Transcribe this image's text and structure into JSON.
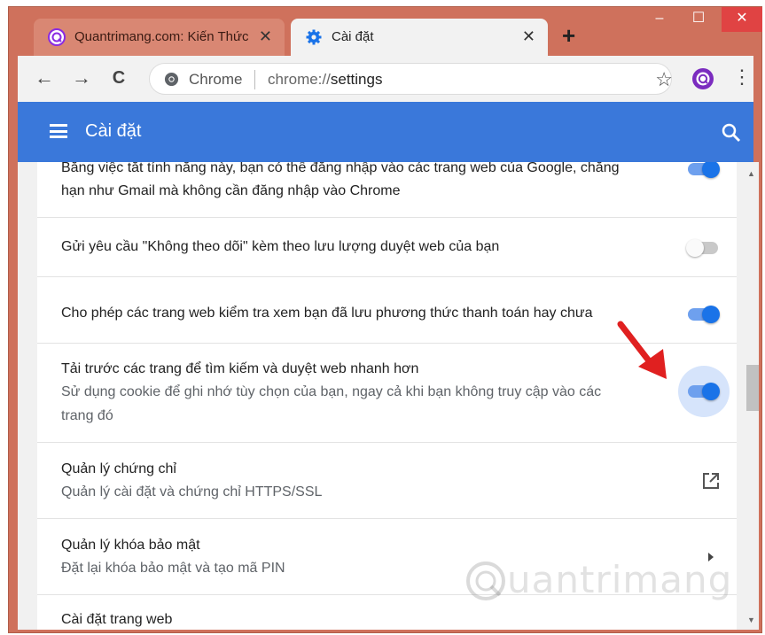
{
  "window": {
    "minimize": "–",
    "maximize": "☐",
    "close": "✕"
  },
  "tabs": [
    {
      "title": "Quantrimang.com: Kiến Thức",
      "close": "✕"
    },
    {
      "title": "Cài đặt",
      "close": "✕"
    }
  ],
  "new_tab": "+",
  "toolbar": {
    "back": "←",
    "forward": "→",
    "reload": "C",
    "chip": "Chrome",
    "url_scheme": "chrome://",
    "url_path": "settings",
    "star": "☆",
    "menu": "⋮"
  },
  "header": {
    "title": "Cài đặt"
  },
  "settings": [
    {
      "primary": "Bằng việc tắt tính năng này, bạn có thể đăng nhập vào các trang web của Google, chẳng",
      "secondary": "hạn như Gmail mà không cần đăng nhập vào Chrome",
      "toggle": "on"
    },
    {
      "primary": "Gửi yêu cầu \"Không theo dõi\" kèm theo lưu lượng duyệt web của bạn",
      "toggle": "off"
    },
    {
      "primary": "Cho phép các trang web kiểm tra xem bạn đã lưu phương thức thanh toán hay chưa",
      "toggle": "on"
    },
    {
      "primary": "Tải trước các trang để tìm kiếm và duyệt web nhanh hơn",
      "secondary": "Sử dụng cookie để ghi nhớ tùy chọn của bạn, ngay cả khi bạn không truy cập vào các",
      "secondary2": "trang đó",
      "toggle": "on"
    },
    {
      "primary": "Quản lý chứng chỉ",
      "secondary": "Quản lý cài đặt và chứng chỉ HTTPS/SSL",
      "action": "external-link"
    },
    {
      "primary": "Quản lý khóa bảo mật",
      "secondary": "Đặt lại khóa bảo mật và tạo mã PIN",
      "action": "chevron-right"
    },
    {
      "primary": "Cài đặt trang web"
    }
  ],
  "scrollbar": {
    "position": 0.48
  },
  "watermark": "uantrimang",
  "colors": {
    "frame": "#cf715c",
    "header": "#3a78da",
    "toggle_on": "#1a73e8",
    "arrow": "#e02020"
  }
}
